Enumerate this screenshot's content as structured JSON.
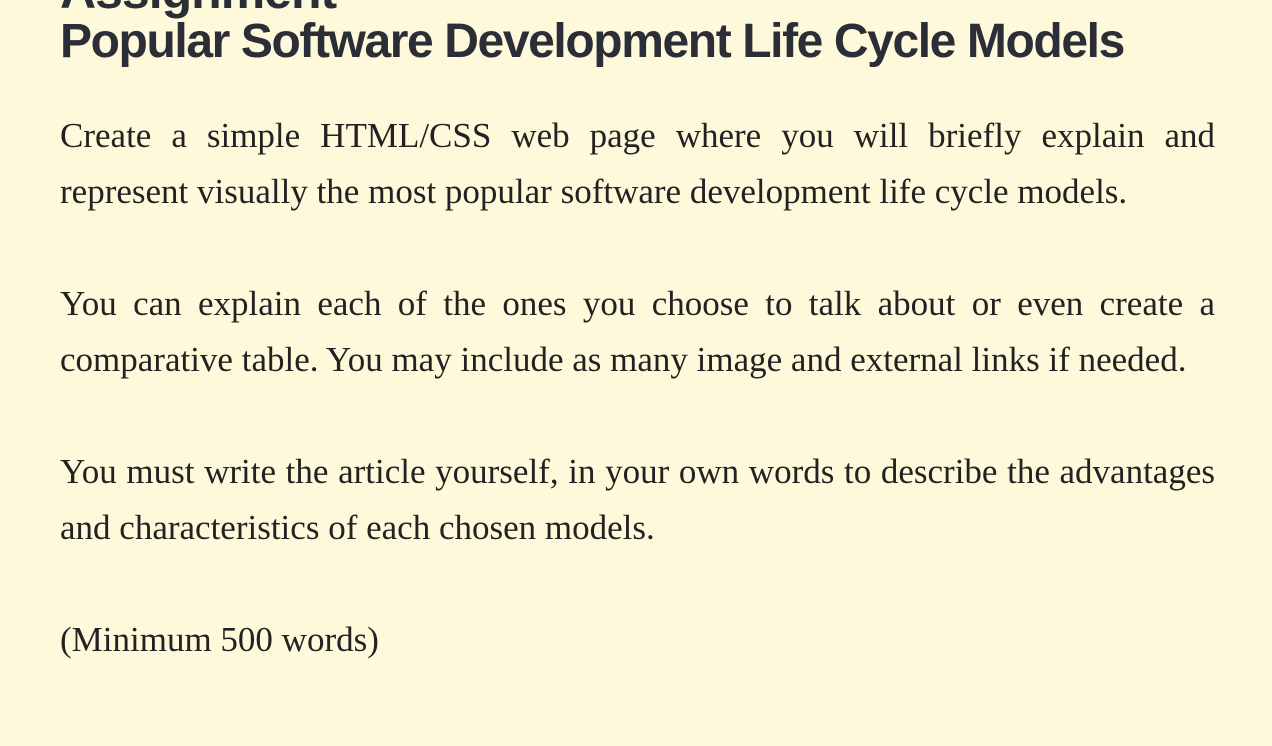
{
  "cut_heading": "Assignment",
  "title": "Popular Software Development Life Cycle Models",
  "paragraphs": [
    "Create a simple HTML/CSS web page where you will briefly explain and represent visually the most popular software development life cycle models.",
    "You can explain each of the ones you choose to talk about or even create a comparative table. You may include as many image and external links if needed.",
    "You must write the article yourself, in your own words to describe the ad­vantages and characteristics of each chosen models.",
    "(Minimum 500 words)"
  ],
  "colors": {
    "background": "#fff9db",
    "heading": "#2b2e36",
    "text": "#222222"
  }
}
